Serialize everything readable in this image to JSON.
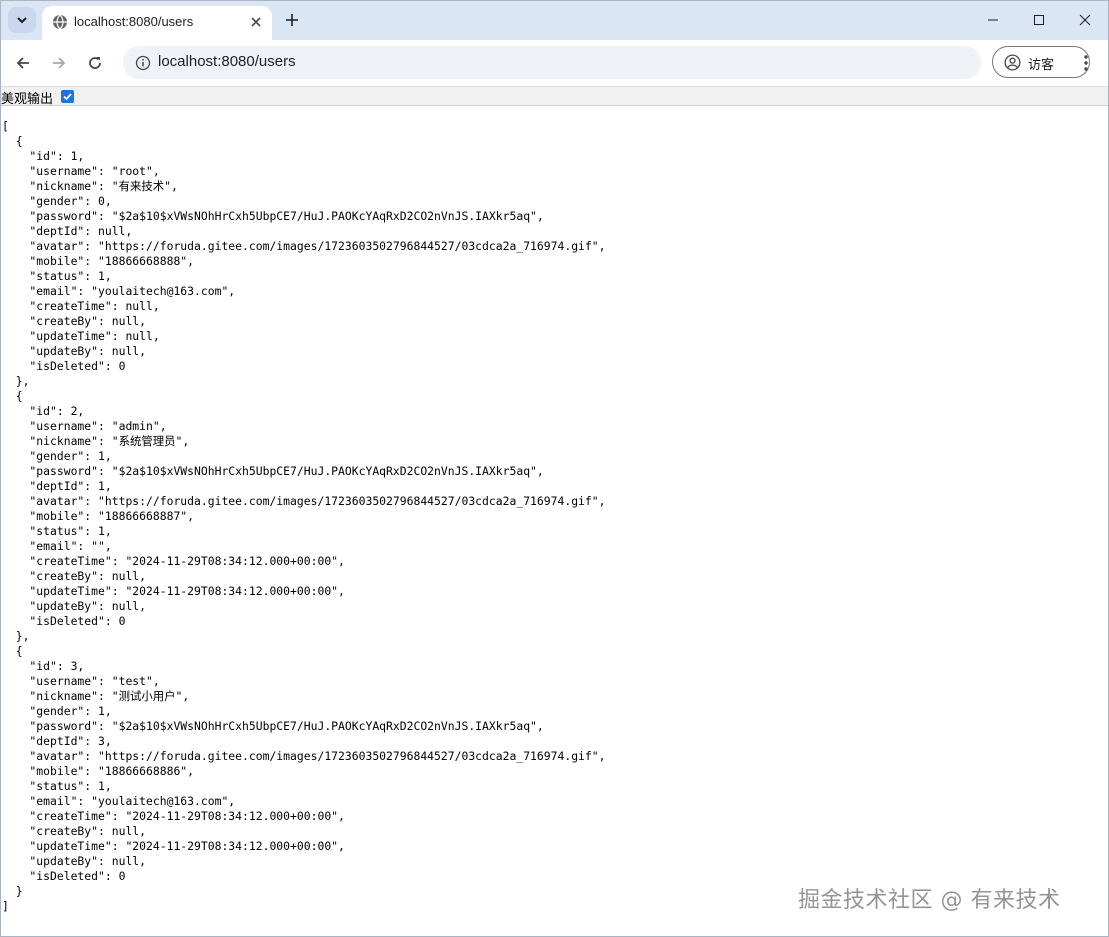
{
  "browser": {
    "tab_title": "localhost:8080/users",
    "url": "localhost:8080/users",
    "profile_label": "访客"
  },
  "pretty_print": {
    "label": "美观输出",
    "checked": true
  },
  "json_text": "[\n  {\n    \"id\": 1,\n    \"username\": \"root\",\n    \"nickname\": \"有来技术\",\n    \"gender\": 0,\n    \"password\": \"$2a$10$xVWsNOhHrCxh5UbpCE7/HuJ.PAOKcYAqRxD2CO2nVnJS.IAXkr5aq\",\n    \"deptId\": null,\n    \"avatar\": \"https://foruda.gitee.com/images/1723603502796844527/03cdca2a_716974.gif\",\n    \"mobile\": \"18866668888\",\n    \"status\": 1,\n    \"email\": \"youlaitech@163.com\",\n    \"createTime\": null,\n    \"createBy\": null,\n    \"updateTime\": null,\n    \"updateBy\": null,\n    \"isDeleted\": 0\n  },\n  {\n    \"id\": 2,\n    \"username\": \"admin\",\n    \"nickname\": \"系统管理员\",\n    \"gender\": 1,\n    \"password\": \"$2a$10$xVWsNOhHrCxh5UbpCE7/HuJ.PAOKcYAqRxD2CO2nVnJS.IAXkr5aq\",\n    \"deptId\": 1,\n    \"avatar\": \"https://foruda.gitee.com/images/1723603502796844527/03cdca2a_716974.gif\",\n    \"mobile\": \"18866668887\",\n    \"status\": 1,\n    \"email\": \"\",\n    \"createTime\": \"2024-11-29T08:34:12.000+00:00\",\n    \"createBy\": null,\n    \"updateTime\": \"2024-11-29T08:34:12.000+00:00\",\n    \"updateBy\": null,\n    \"isDeleted\": 0\n  },\n  {\n    \"id\": 3,\n    \"username\": \"test\",\n    \"nickname\": \"测试小用户\",\n    \"gender\": 1,\n    \"password\": \"$2a$10$xVWsNOhHrCxh5UbpCE7/HuJ.PAOKcYAqRxD2CO2nVnJS.IAXkr5aq\",\n    \"deptId\": 3,\n    \"avatar\": \"https://foruda.gitee.com/images/1723603502796844527/03cdca2a_716974.gif\",\n    \"mobile\": \"18866668886\",\n    \"status\": 1,\n    \"email\": \"youlaitech@163.com\",\n    \"createTime\": \"2024-11-29T08:34:12.000+00:00\",\n    \"createBy\": null,\n    \"updateTime\": \"2024-11-29T08:34:12.000+00:00\",\n    \"updateBy\": null,\n    \"isDeleted\": 0\n  }\n]",
  "watermark": "掘金技术社区 @ 有来技术",
  "icons": {
    "tab_search": "chevron-down-icon",
    "favicon": "globe-icon",
    "tab_close": "close-icon",
    "new_tab": "plus-icon",
    "minimize": "minimize-icon",
    "maximize": "maximize-icon",
    "close_window": "close-icon",
    "back": "arrow-left-icon",
    "forward": "arrow-right-icon",
    "reload": "reload-icon",
    "site_info": "info-icon",
    "profile": "person-circle-icon",
    "menu": "more-vert-icon"
  },
  "colors": {
    "tabstrip_bg": "#dbe6f5",
    "omnibox_bg": "#eff3f8",
    "checkbox_accent": "#1a73e8"
  }
}
